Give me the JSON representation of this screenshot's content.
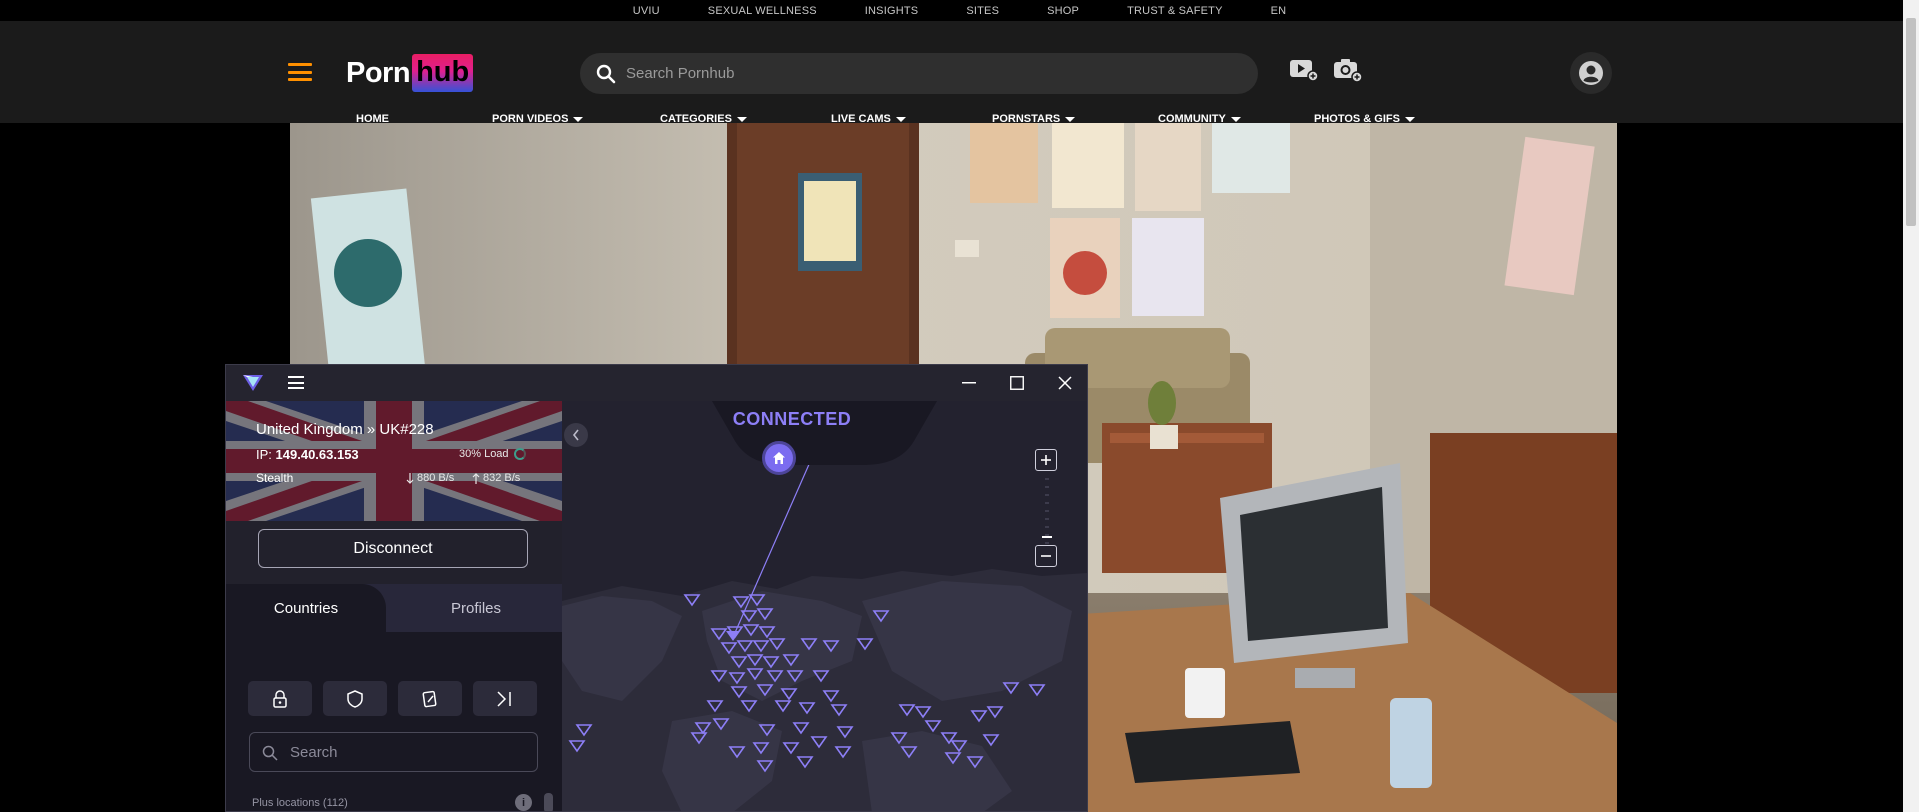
{
  "top_strip": [
    "UVIU",
    "SEXUAL WELLNESS",
    "INSIGHTS",
    "SITES",
    "SHOP",
    "TRUST & SAFETY",
    "EN"
  ],
  "header": {
    "logo_left": "Porn",
    "logo_right": "hub",
    "search_placeholder": "Search Pornhub",
    "nav": [
      {
        "label": "HOME",
        "dropdown": false
      },
      {
        "label": "PORN VIDEOS",
        "dropdown": true
      },
      {
        "label": "CATEGORIES",
        "dropdown": true
      },
      {
        "label": "LIVE CAMS",
        "dropdown": true
      },
      {
        "label": "PORNSTARS",
        "dropdown": true
      },
      {
        "label": "COMMUNITY",
        "dropdown": true
      },
      {
        "label": "PHOTOS & GIFS",
        "dropdown": true
      }
    ],
    "accent": "#ff9000"
  },
  "vpn": {
    "server": "United Kingdom » UK#228",
    "ip_label": "IP:",
    "ip": "149.40.63.153",
    "load": "30% Load",
    "protocol": "Stealth",
    "download": "880 B/s",
    "upload": "832 B/s",
    "disconnect": "Disconnect",
    "tabs": {
      "countries": "Countries",
      "profiles": "Profiles"
    },
    "search_placeholder": "Search",
    "plus_locations": "Plus locations (112)",
    "info": "i",
    "status": "CONNECTED",
    "accent": "#7b6cf0"
  }
}
